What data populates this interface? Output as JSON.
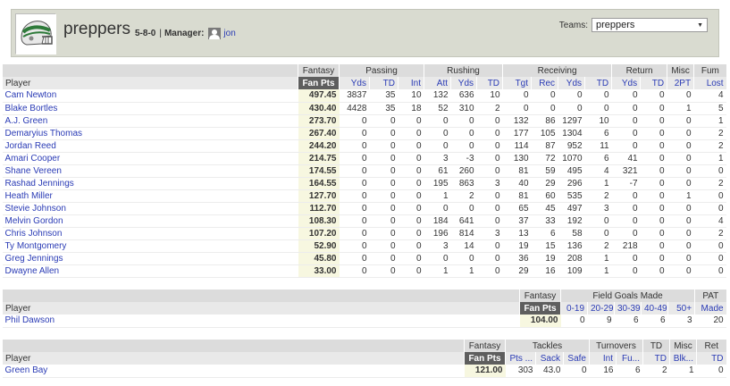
{
  "team": {
    "name": "preppers",
    "record": "5-8-0",
    "manager_label": "Manager:",
    "manager_name": "jon",
    "teams_label": "Teams:",
    "teams_selected": "preppers"
  },
  "offense": {
    "groups": [
      "Fantasy",
      "Passing",
      "Rushing",
      "Receiving",
      "Return",
      "Misc",
      "Fum"
    ],
    "subheaders": [
      "Player",
      "Fan Pts",
      "Yds",
      "TD",
      "Int",
      "Att",
      "Yds",
      "TD",
      "Tgt",
      "Rec",
      "Yds",
      "TD",
      "Yds",
      "TD",
      "2PT",
      "Lost"
    ],
    "rows": [
      [
        "Cam Newton",
        "497.45",
        "3837",
        "35",
        "10",
        "132",
        "636",
        "10",
        "0",
        "0",
        "0",
        "0",
        "0",
        "0",
        "0",
        "4"
      ],
      [
        "Blake Bortles",
        "430.40",
        "4428",
        "35",
        "18",
        "52",
        "310",
        "2",
        "0",
        "0",
        "0",
        "0",
        "0",
        "0",
        "1",
        "5"
      ],
      [
        "A.J. Green",
        "273.70",
        "0",
        "0",
        "0",
        "0",
        "0",
        "0",
        "132",
        "86",
        "1297",
        "10",
        "0",
        "0",
        "0",
        "1"
      ],
      [
        "Demaryius Thomas",
        "267.40",
        "0",
        "0",
        "0",
        "0",
        "0",
        "0",
        "177",
        "105",
        "1304",
        "6",
        "0",
        "0",
        "0",
        "2"
      ],
      [
        "Jordan Reed",
        "244.20",
        "0",
        "0",
        "0",
        "0",
        "0",
        "0",
        "114",
        "87",
        "952",
        "11",
        "0",
        "0",
        "0",
        "2"
      ],
      [
        "Amari Cooper",
        "214.75",
        "0",
        "0",
        "0",
        "3",
        "-3",
        "0",
        "130",
        "72",
        "1070",
        "6",
        "41",
        "0",
        "0",
        "1"
      ],
      [
        "Shane Vereen",
        "174.55",
        "0",
        "0",
        "0",
        "61",
        "260",
        "0",
        "81",
        "59",
        "495",
        "4",
        "321",
        "0",
        "0",
        "0"
      ],
      [
        "Rashad Jennings",
        "164.55",
        "0",
        "0",
        "0",
        "195",
        "863",
        "3",
        "40",
        "29",
        "296",
        "1",
        "-7",
        "0",
        "0",
        "2"
      ],
      [
        "Heath Miller",
        "127.70",
        "0",
        "0",
        "0",
        "1",
        "2",
        "0",
        "81",
        "60",
        "535",
        "2",
        "0",
        "0",
        "1",
        "0"
      ],
      [
        "Stevie Johnson",
        "112.70",
        "0",
        "0",
        "0",
        "0",
        "0",
        "0",
        "65",
        "45",
        "497",
        "3",
        "0",
        "0",
        "0",
        "0"
      ],
      [
        "Melvin Gordon",
        "108.30",
        "0",
        "0",
        "0",
        "184",
        "641",
        "0",
        "37",
        "33",
        "192",
        "0",
        "0",
        "0",
        "0",
        "4"
      ],
      [
        "Chris Johnson",
        "107.20",
        "0",
        "0",
        "0",
        "196",
        "814",
        "3",
        "13",
        "6",
        "58",
        "0",
        "0",
        "0",
        "0",
        "2"
      ],
      [
        "Ty Montgomery",
        "52.90",
        "0",
        "0",
        "0",
        "3",
        "14",
        "0",
        "19",
        "15",
        "136",
        "2",
        "218",
        "0",
        "0",
        "0"
      ],
      [
        "Greg Jennings",
        "45.80",
        "0",
        "0",
        "0",
        "0",
        "0",
        "0",
        "36",
        "19",
        "208",
        "1",
        "0",
        "0",
        "0",
        "0"
      ],
      [
        "Dwayne Allen",
        "33.00",
        "0",
        "0",
        "0",
        "1",
        "1",
        "0",
        "29",
        "16",
        "109",
        "1",
        "0",
        "0",
        "0",
        "0"
      ]
    ]
  },
  "kicker": {
    "groups": [
      "Fantasy",
      "Field Goals Made",
      "PAT"
    ],
    "subheaders": [
      "Player",
      "Fan Pts",
      "0-19",
      "20-29",
      "30-39",
      "40-49",
      "50+",
      "Made"
    ],
    "rows": [
      [
        "Phil Dawson",
        "104.00",
        "0",
        "9",
        "6",
        "6",
        "3",
        "20"
      ]
    ]
  },
  "defense": {
    "groups": [
      "Fantasy",
      "Tackles",
      "Turnovers",
      "TD",
      "Misc",
      "Ret"
    ],
    "subheaders": [
      "Player",
      "Fan Pts",
      "Pts ...",
      "Sack",
      "Safe",
      "Int",
      "Fu...",
      "TD",
      "Blk...",
      "TD"
    ],
    "rows": [
      [
        "Green Bay",
        "121.00",
        "303",
        "43.0",
        "0",
        "16",
        "6",
        "2",
        "1",
        "0"
      ]
    ]
  },
  "colors": {
    "header_bg": "#d9dbd0",
    "link": "#2a3bb5",
    "fanpts_header_bg": "#5e5e5e",
    "fanpts_cell_bg": "#f7f7e0"
  },
  "icons": {
    "logo": "football-helmet-logo",
    "avatar": "user-avatar-icon",
    "dropdown": "chevron-down-icon"
  }
}
